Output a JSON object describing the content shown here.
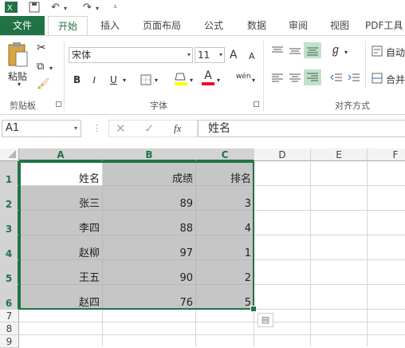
{
  "quick_access": {
    "app_icon": "excel-logo-icon",
    "save_icon": "save-icon",
    "undo_icon": "undo-icon",
    "redo_icon": "redo-icon",
    "customize_icon": "customize-qat-icon"
  },
  "ribbon_tabs": [
    "文件",
    "开始",
    "插入",
    "页面布局",
    "公式",
    "数据",
    "审阅",
    "视图",
    "PDF工具"
  ],
  "active_tab": "开始",
  "clipboard": {
    "paste_label": "粘贴",
    "group_label": "剪贴板"
  },
  "font": {
    "font_name": "宋体",
    "font_size": "11",
    "grow_label": "A",
    "shrink_label": "A",
    "bold": "B",
    "italic": "I",
    "underline": "U",
    "font_color_label": "A",
    "phonetic_label": "wén",
    "group_label": "字体"
  },
  "alignment": {
    "wrap_label": "自动",
    "merge_label": "合并",
    "group_label": "对齐方式"
  },
  "formula_bar": {
    "name_box": "A1",
    "fx_label": "fx",
    "formula": "姓名"
  },
  "colors": {
    "excel_green": "#217346",
    "selection_gray": "#c6c6c6",
    "font_color_red": "#e81123",
    "fill_yellow": "#ffff00"
  },
  "sheet": {
    "columns": [
      "A",
      "B",
      "C",
      "D",
      "E",
      "F"
    ],
    "rows": [
      "1",
      "2",
      "3",
      "4",
      "5",
      "6",
      "7",
      "8",
      "9"
    ],
    "headers": [
      "姓名",
      "成绩",
      "排名"
    ],
    "data": [
      [
        "张三",
        "89",
        "3"
      ],
      [
        "李四",
        "88",
        "4"
      ],
      [
        "赵柳",
        "97",
        "1"
      ],
      [
        "王五",
        "90",
        "2"
      ],
      [
        "赵四",
        "76",
        "5"
      ]
    ]
  }
}
